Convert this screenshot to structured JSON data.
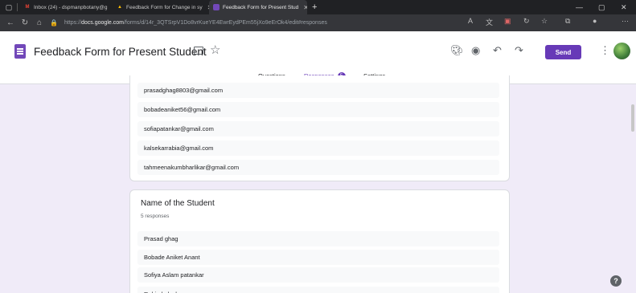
{
  "browser": {
    "tabs": [
      {
        "label": "Inbox (24) - dspmanpbotany@g",
        "icon": "gmail-icon",
        "color": "#ea4335"
      },
      {
        "label": "Feedback Form for Change in sy",
        "icon": "drive-icon",
        "color": "#fbbc04"
      },
      {
        "label": "Feedback Form for Present Stud",
        "icon": "forms-icon",
        "color": "#7248b9"
      }
    ],
    "url_prefix": "https://",
    "url_host": "docs.google.com",
    "url_path": "/forms/d/14r_3QTSrpV1Do8vrKueYE4EwrEydPEm55jXo9eErOk4/edit#responses"
  },
  "form": {
    "title": "Feedback Form for Present Student",
    "send_label": "Send",
    "tabs": {
      "questions": "Questions",
      "responses": "Responses",
      "responses_count": "5",
      "settings": "Settings"
    }
  },
  "email_responses": [
    "prasadghag8803@gmail.com",
    "bobadeaniket56@gmail.com",
    "sofiapatankar@gmail.com",
    "kalsekarrabia@gmail.com",
    "tahmeenakumbharlikar@gmail.com"
  ],
  "name_question": {
    "title": "Name of the Student",
    "count": "5 responses",
    "responses": [
      "Prasad ghag",
      "Bobade Aniket Anant",
      "Sofiya Aslam patankar",
      "Rabia kalsekar"
    ]
  },
  "colors": {
    "accent": "#673ab7",
    "page_bg": "#f0ebf8"
  }
}
